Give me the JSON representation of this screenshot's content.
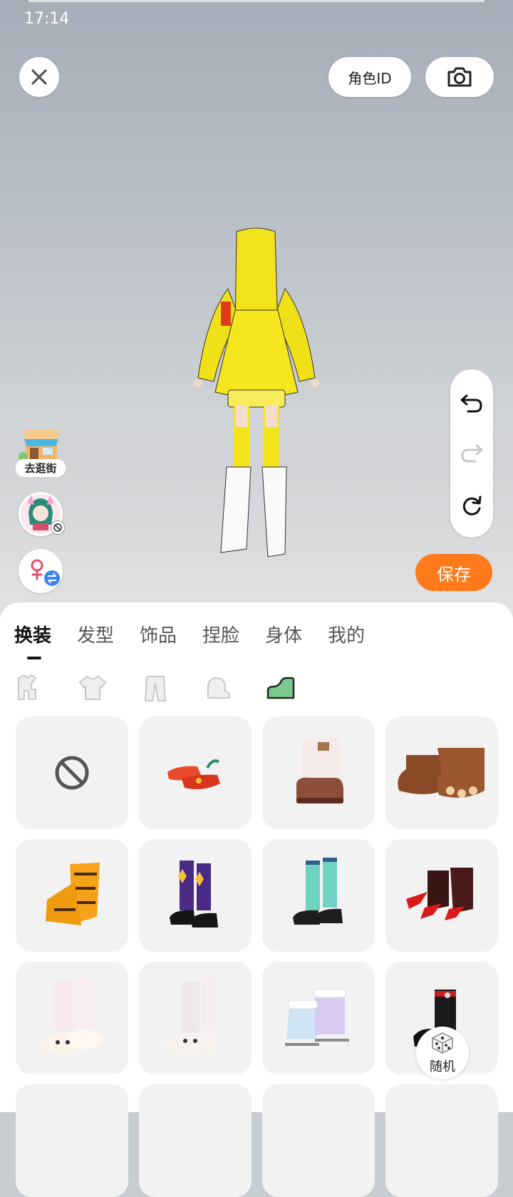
{
  "status_bar": {
    "time": "17:14"
  },
  "header": {
    "role_id_label": "角色ID"
  },
  "left_shortcuts": {
    "street_label": "去逛街"
  },
  "actions": {
    "save_label": "保存",
    "random_label": "随机"
  },
  "tabs": [
    {
      "label": "换装",
      "active": true
    },
    {
      "label": "发型"
    },
    {
      "label": "饰品"
    },
    {
      "label": "捏脸"
    },
    {
      "label": "身体"
    },
    {
      "label": "我的"
    }
  ],
  "categories": [
    "outfit-set-icon",
    "top-icon",
    "pants-icon",
    "socks-icon",
    "shoes-icon"
  ],
  "selected_category": "shoes-icon",
  "items": [
    {
      "name": "none"
    },
    {
      "name": "red-flower-shoes"
    },
    {
      "name": "fur-brown-boots"
    },
    {
      "name": "animal-paw-shoes"
    },
    {
      "name": "orange-tiger-boots"
    },
    {
      "name": "argyle-socks-mary-janes"
    },
    {
      "name": "teal-socks-mary-janes"
    },
    {
      "name": "red-claw-boots"
    },
    {
      "name": "bunny-slippers-pink"
    },
    {
      "name": "bunny-slippers-white"
    },
    {
      "name": "holographic-ice-skates"
    },
    {
      "name": "black-red-boots"
    }
  ],
  "colors": {
    "accent": "#ff7a1a",
    "selected_category": "#7bc98f"
  }
}
